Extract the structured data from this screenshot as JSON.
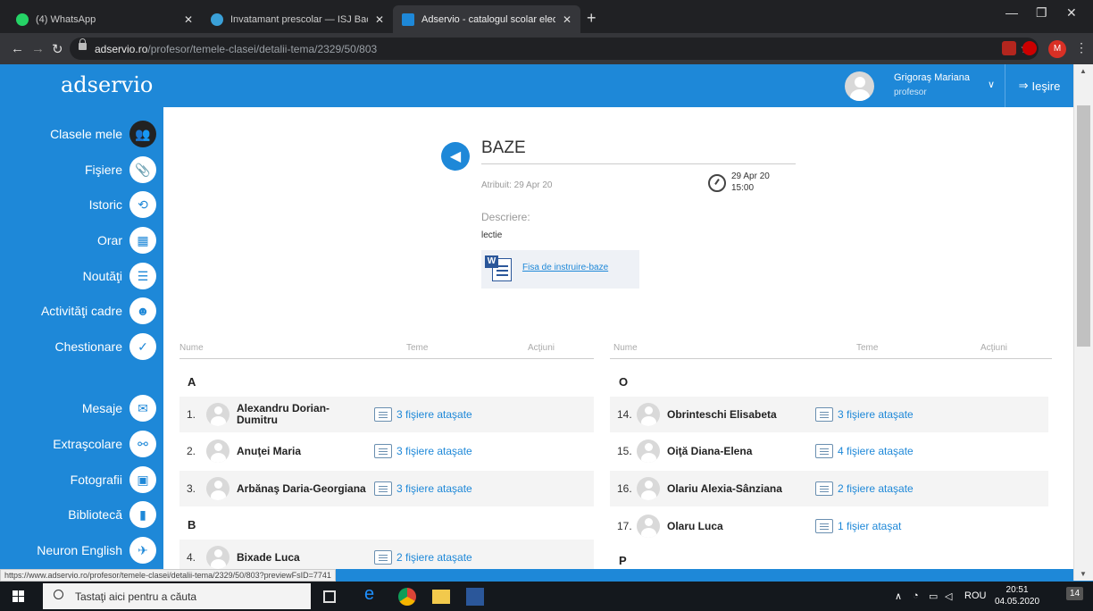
{
  "browser": {
    "tabs": [
      {
        "title": "(4) WhatsApp",
        "active": false,
        "favicon_color": "#25d366"
      },
      {
        "title": "Invatamant prescolar — ISJ Bacau",
        "active": false,
        "favicon_color": "#3aa0d8"
      },
      {
        "title": "Adservio - catalogul scolar electronic",
        "active": true,
        "favicon_color": "#1e88d8"
      }
    ],
    "close_glyph": "✕",
    "new_tab_glyph": "+",
    "url_host": "adservio.ro",
    "url_path": "/profesor/temele-clasei/detalii-tema/2329/50/803",
    "profile_initial": "M"
  },
  "header": {
    "logo": "adservio",
    "user_name": "Grigoraş Mariana",
    "user_role": "profesor",
    "logout_label": "Ieşire"
  },
  "sidebar": {
    "items": [
      {
        "label": "Clasele mele",
        "icon": "users-icon",
        "glyph": "👥"
      },
      {
        "label": "Fişiere",
        "icon": "paperclip-icon",
        "glyph": "📎"
      },
      {
        "label": "Istoric",
        "icon": "history-icon",
        "glyph": "⟲"
      },
      {
        "label": "Orar",
        "icon": "calendar-icon",
        "glyph": "▦"
      },
      {
        "label": "Noutăţi",
        "icon": "news-icon",
        "glyph": "☰"
      },
      {
        "label": "Activităţi cadre",
        "icon": "group-icon",
        "glyph": "☻"
      },
      {
        "label": "Chestionare",
        "icon": "checklist-icon",
        "glyph": "✓"
      },
      {
        "label": "Mesaje",
        "icon": "envelope-icon",
        "glyph": "✉"
      },
      {
        "label": "Extraşcolare",
        "icon": "activities-icon",
        "glyph": "⚯"
      },
      {
        "label": "Fotografii",
        "icon": "photo-icon",
        "glyph": "▣"
      },
      {
        "label": "Bibliotecă",
        "icon": "library-icon",
        "glyph": "▮"
      },
      {
        "label": "Neuron English",
        "icon": "paper-plane-icon",
        "glyph": "✈"
      }
    ]
  },
  "homework": {
    "title": "BAZE",
    "assigned": "Atribuit: 29 Apr 20",
    "due_date": "29 Apr 20",
    "due_time": "15:00",
    "description_label": "Descriere:",
    "description": "lectie",
    "attachment_name": "Fisa de instruire-baze"
  },
  "students_table": {
    "columns": {
      "name": "Nume",
      "homework": "Teme",
      "actions": "Acţiuni"
    },
    "left": [
      {
        "type": "letter",
        "text": "A"
      },
      {
        "type": "student",
        "num": "1.",
        "name": "Alexandru Dorian-Dumitru",
        "files": "3 fişiere ataşate"
      },
      {
        "type": "student",
        "num": "2.",
        "name": "Anuţei Maria",
        "files": "3 fişiere ataşate"
      },
      {
        "type": "student",
        "num": "3.",
        "name": "Arbănaş Daria-Georgiana",
        "files": "3 fişiere ataşate"
      },
      {
        "type": "letter",
        "text": "B"
      },
      {
        "type": "student",
        "num": "4.",
        "name": "Bixade Luca",
        "files": "2 fişiere ataşate"
      }
    ],
    "right": [
      {
        "type": "letter",
        "text": "O"
      },
      {
        "type": "student",
        "num": "14.",
        "name": "Obrinteschi Elisabeta",
        "files": "3 fişiere ataşate"
      },
      {
        "type": "student",
        "num": "15.",
        "name": "Oiţă Diana-Elena",
        "files": "4 fişiere ataşate"
      },
      {
        "type": "student",
        "num": "16.",
        "name": "Olariu Alexia-Sânziana",
        "files": "2 fişiere ataşate"
      },
      {
        "type": "student",
        "num": "17.",
        "name": "Olaru Luca",
        "files": "1 fişier ataşat"
      },
      {
        "type": "letter",
        "text": "P"
      }
    ]
  },
  "status_url": "https://www.adservio.ro/profesor/temele-clasei/detalii-tema/2329/50/803?previewFsID=7741",
  "taskbar": {
    "search_placeholder": "Tastaţi aici pentru a căuta",
    "language": "ROU",
    "time": "20:51",
    "date": "04.05.2020",
    "notifications": "14"
  },
  "colors": {
    "brand": "#1e88d8",
    "link": "#1e88d8"
  }
}
